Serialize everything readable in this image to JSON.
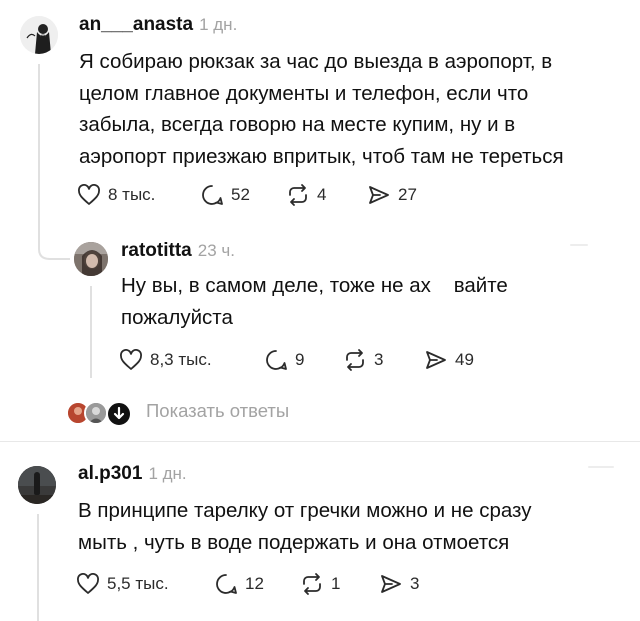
{
  "comments": [
    {
      "username": "an___anasta",
      "time": "1 дн.",
      "text": "Я собираю рюкзак за час до выезда в аэропорт, в\nцелом главное документы и телефон, если что\nзабыла, всегда говорю на месте купим, ну и в\nаэропорт приезжаю впритык, чтоб там не тереться",
      "likes": "8 тыс.",
      "replies": "52",
      "reposts": "4",
      "shares": "27"
    },
    {
      "username": "ratotitta",
      "time": "23 ч.",
      "text": "Ну вы, в самом деле, тоже не ах    вайте\nпожалуйста",
      "likes": "8,3 тыс.",
      "replies": "9",
      "reposts": "3",
      "shares": "49"
    },
    {
      "username": "al.p301",
      "time": "1 дн.",
      "text": "В принципе тарелку от гречки можно и не сразу\nмыть , чуть в воде подержать и она отмоется",
      "likes": "5,5 тыс.",
      "replies": "12",
      "reposts": "1",
      "shares": "3"
    }
  ],
  "show_replies": "Показать ответы",
  "icons": {
    "like": "heart-icon",
    "reply": "speech-bubble-icon",
    "repost": "repost-icon",
    "share": "send-icon",
    "show_replies": "chevron-down-icon"
  },
  "colors": {
    "text": "#111111",
    "muted": "#a3a3a3",
    "divider": "#e8e8e8"
  }
}
